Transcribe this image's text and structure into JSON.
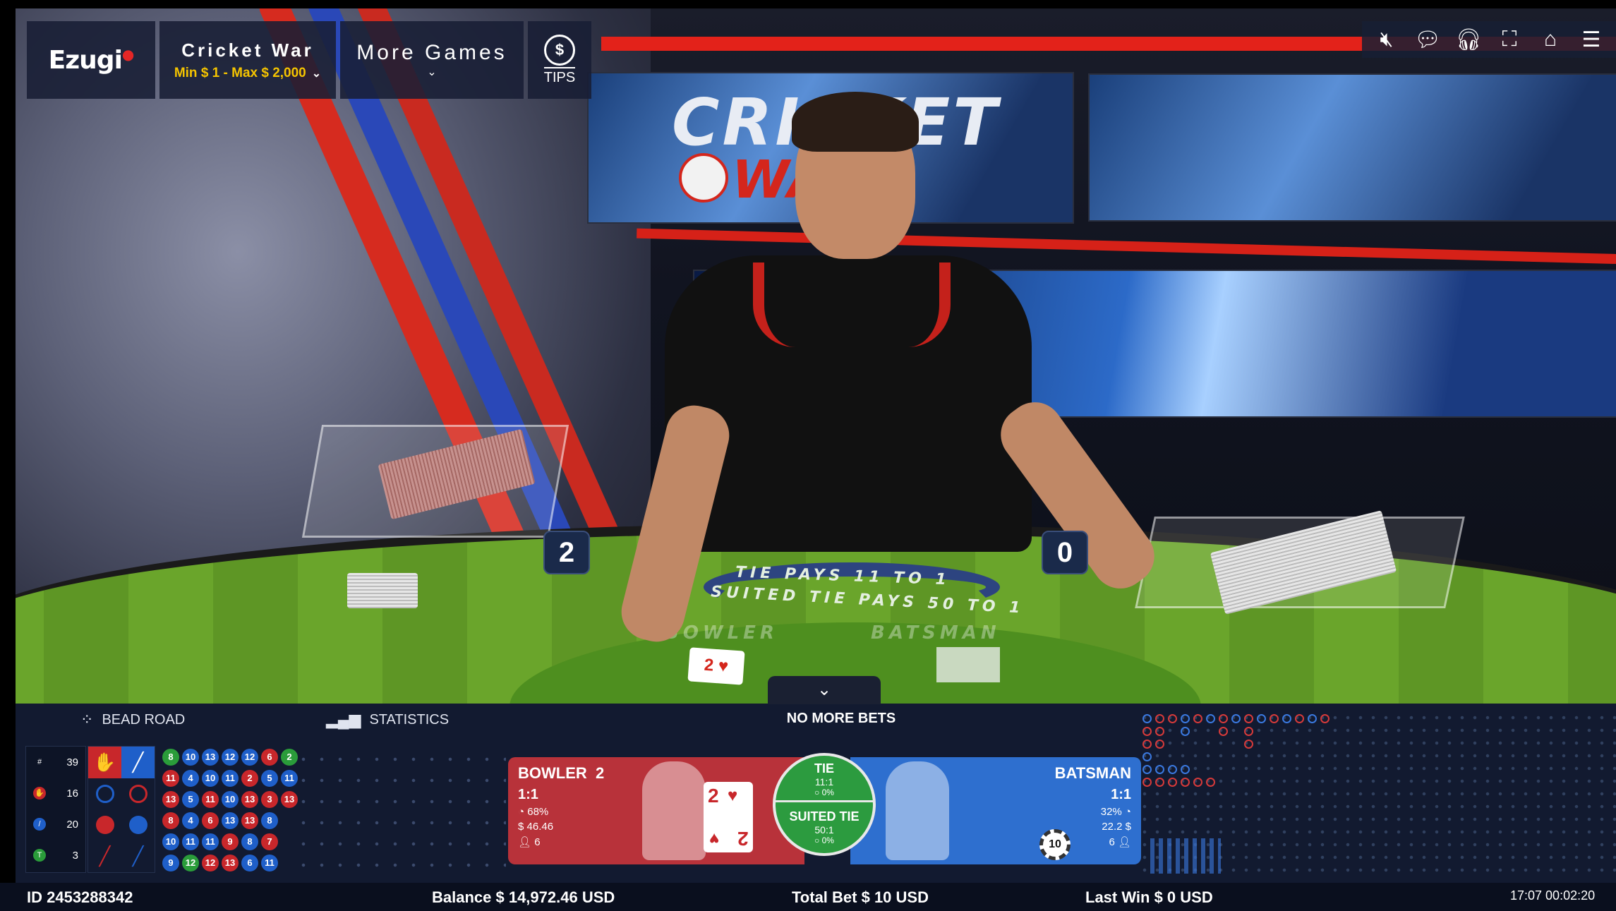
{
  "header": {
    "logo": "Ezugi",
    "game_title": "Cricket War",
    "limits": "Min $ 1 - Max $ 2,000",
    "more_games": "More Games",
    "tips_symbol": "$",
    "tips_label": "TIPS"
  },
  "top_icons": [
    "mute-icon",
    "chat-icon",
    "support-icon",
    "fullscreen-icon",
    "home-icon",
    "menu-icon"
  ],
  "video": {
    "brand_top": "CRICKET",
    "brand_bottom": "WAR",
    "score_bowler": "2",
    "score_batsman": "0",
    "felt_line1": "TIE PAYS 11 TO 1",
    "felt_line2": "SUITED TIE PAYS 50 TO 1",
    "felt_bowler": "BOWLER",
    "felt_batsman": "BATSMAN",
    "dealt_card": "2 ♥"
  },
  "panel": {
    "tab_beadroad": "BEAD ROAD",
    "tab_statistics": "STATISTICS",
    "status_message": "NO MORE BETS",
    "counts": [
      {
        "icon": "#",
        "value": "39"
      },
      {
        "icon": "bowler",
        "value": "16"
      },
      {
        "icon": "batsman",
        "value": "20"
      },
      {
        "icon": "tie",
        "value": "3"
      }
    ],
    "bead_rows": [
      [
        {
          "v": "8",
          "c": "g"
        },
        {
          "v": "10",
          "c": "b"
        },
        {
          "v": "13",
          "c": "b"
        },
        {
          "v": "12",
          "c": "b"
        },
        {
          "v": "12",
          "c": "b"
        },
        {
          "v": "6",
          "c": "r"
        },
        {
          "v": "2",
          "c": "g"
        }
      ],
      [
        {
          "v": "11",
          "c": "r"
        },
        {
          "v": "4",
          "c": "b"
        },
        {
          "v": "10",
          "c": "b"
        },
        {
          "v": "11",
          "c": "b"
        },
        {
          "v": "2",
          "c": "r"
        },
        {
          "v": "5",
          "c": "b"
        },
        {
          "v": "11",
          "c": "b"
        }
      ],
      [
        {
          "v": "13",
          "c": "r"
        },
        {
          "v": "5",
          "c": "b"
        },
        {
          "v": "11",
          "c": "r"
        },
        {
          "v": "10",
          "c": "b"
        },
        {
          "v": "13",
          "c": "r"
        },
        {
          "v": "3",
          "c": "r"
        },
        {
          "v": "13",
          "c": "r"
        }
      ],
      [
        {
          "v": "8",
          "c": "r"
        },
        {
          "v": "4",
          "c": "b"
        },
        {
          "v": "6",
          "c": "r"
        },
        {
          "v": "13",
          "c": "b"
        },
        {
          "v": "13",
          "c": "r"
        },
        {
          "v": "8",
          "c": "b"
        }
      ],
      [
        {
          "v": "10",
          "c": "b"
        },
        {
          "v": "11",
          "c": "b"
        },
        {
          "v": "11",
          "c": "b"
        },
        {
          "v": "9",
          "c": "r"
        },
        {
          "v": "8",
          "c": "b"
        },
        {
          "v": "7",
          "c": "r"
        }
      ],
      [
        {
          "v": "9",
          "c": "b"
        },
        {
          "v": "12",
          "c": "g"
        },
        {
          "v": "12",
          "c": "r"
        },
        {
          "v": "13",
          "c": "r"
        },
        {
          "v": "6",
          "c": "b"
        },
        {
          "v": "11",
          "c": "b"
        }
      ]
    ],
    "bowler": {
      "name": "BOWLER",
      "score": "2",
      "odds": "1:1",
      "pct": "68%",
      "amount": "$ 46.46",
      "players": "6",
      "card_rank": "2",
      "card_suit": "♥"
    },
    "tie": {
      "title": "TIE",
      "odds": "11:1",
      "pct": "0%",
      "suited_title": "SUITED TIE",
      "suited_odds": "50:1",
      "suited_pct": "0%"
    },
    "batsman": {
      "name": "BATSMAN",
      "odds": "1:1",
      "pct": "32%",
      "amount": "22.2 $",
      "players": "6"
    },
    "chip_value": "10"
  },
  "status": {
    "id": "ID 2453288342",
    "balance": "Balance  $ 14,972.46 USD",
    "total_bet": "Total Bet $ 10 USD",
    "last_win": "Last Win $ 0 USD",
    "time": "17:07  00:02:20"
  },
  "colors": {
    "bowler": "#b8323a",
    "batsman": "#2e6fcf",
    "tie": "#2c9b3f",
    "limits": "#f5c400",
    "panel_bg": "#121a30"
  }
}
